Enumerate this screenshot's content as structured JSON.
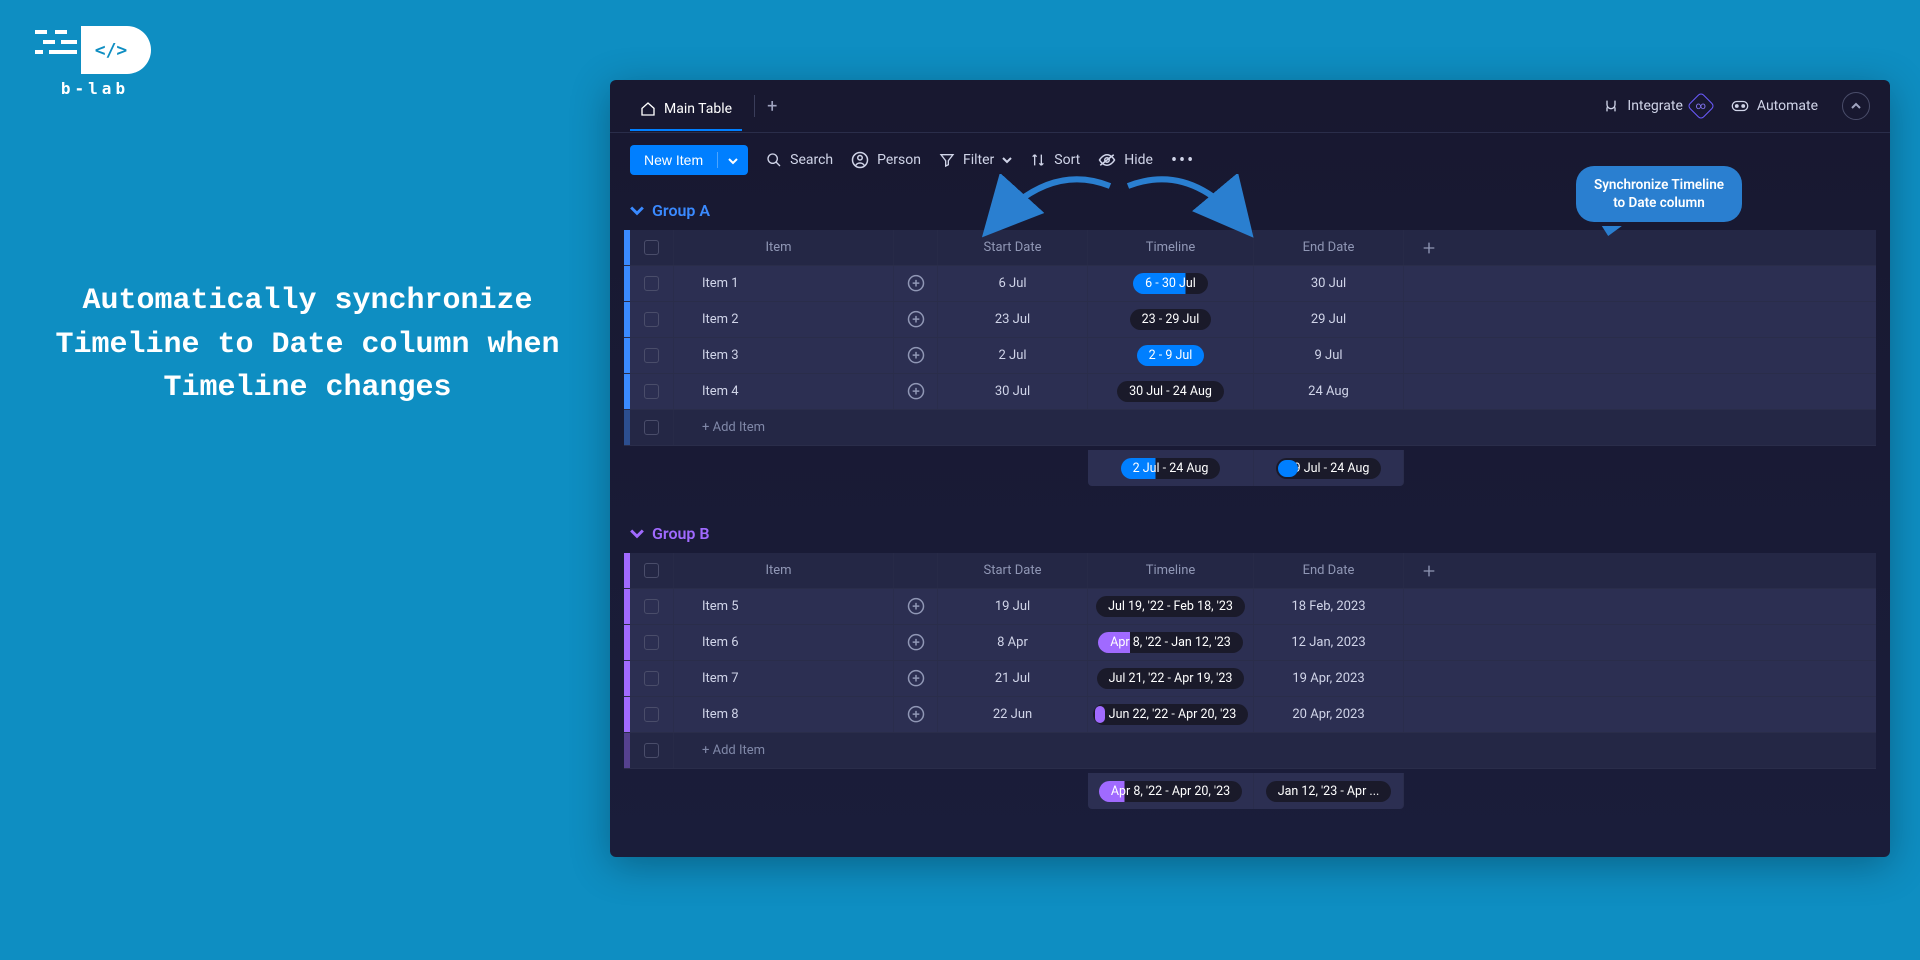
{
  "logo": {
    "label": "b-lab"
  },
  "headline": "Automatically synchronize\nTimeline to Date column when Timeline changes",
  "topbar": {
    "tab_label": "Main Table",
    "integrate": "Integrate",
    "automate": "Automate"
  },
  "toolbar": {
    "new_item": "New Item",
    "search": "Search",
    "person": "Person",
    "filter": "Filter",
    "sort": "Sort",
    "hide": "Hide"
  },
  "callout": "Synchronize Timeline\nto Date column",
  "columns": {
    "item": "Item",
    "start_date": "Start Date",
    "timeline": "Timeline",
    "end_date": "End Date"
  },
  "add_item": "+ Add Item",
  "groups": [
    {
      "name": "Group A",
      "color": "a",
      "rows": [
        {
          "item": "Item 1",
          "start": "6 Jul",
          "timeline": "6 - 30 Jul",
          "pill": "pill-blue",
          "end": "30 Jul"
        },
        {
          "item": "Item 2",
          "start": "23 Jul",
          "timeline": "23 - 29 Jul",
          "pill": "pill-dark",
          "end": "29 Jul"
        },
        {
          "item": "Item 3",
          "start": "2 Jul",
          "timeline": "2 - 9 Jul",
          "pill": "pill-blue-full",
          "end": "9 Jul"
        },
        {
          "item": "Item 4",
          "start": "30 Jul",
          "timeline": "30 Jul - 24 Aug",
          "pill": "pill-dark",
          "end": "24 Aug"
        }
      ],
      "footer": {
        "timeline": "2 Jul - 24 Aug",
        "timeline_pill": "pill-blue-range",
        "end": "9 Jul - 24 Aug",
        "end_pill": "pill-blue-small"
      }
    },
    {
      "name": "Group B",
      "color": "b",
      "rows": [
        {
          "item": "Item 5",
          "start": "19 Jul",
          "timeline": "Jul 19, '22 - Feb 18, '23",
          "pill": "pill-dark",
          "end": "18 Feb, 2023"
        },
        {
          "item": "Item 6",
          "start": "8 Apr",
          "timeline": "Apr 8, '22 - Jan 12, '23",
          "pill": "pill-purple-med",
          "end": "12 Jan, 2023"
        },
        {
          "item": "Item 7",
          "start": "21 Jul",
          "timeline": "Jul 21, '22 - Apr 19, '23",
          "pill": "pill-dark",
          "end": "19 Apr, 2023"
        },
        {
          "item": "Item 8",
          "start": "22 Jun",
          "timeline": "Jun 22, '22 - Apr 20, '23",
          "pill": "pill-purple-small",
          "end": "20 Apr, 2023"
        }
      ],
      "footer": {
        "timeline": "Apr 8, '22 - Apr 20, '23",
        "timeline_pill": "pill-purple-footer",
        "end": "Jan 12, '23 - Apr ...",
        "end_pill": "pill-dark"
      }
    }
  ]
}
